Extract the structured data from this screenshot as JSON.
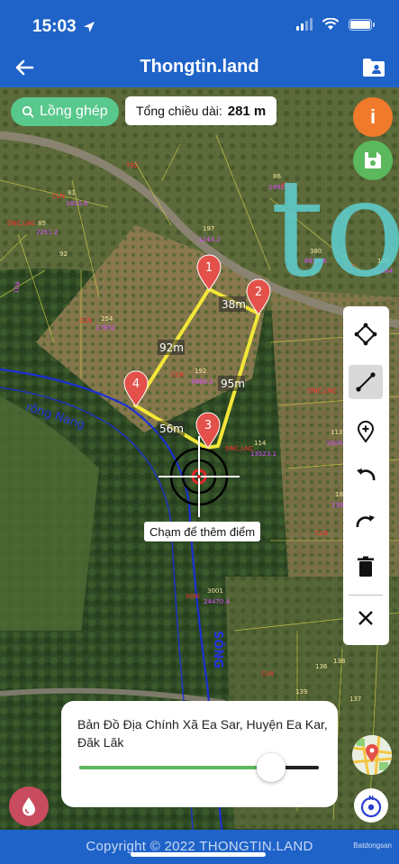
{
  "status": {
    "time": "15:03"
  },
  "header": {
    "title": "Thongtin.land"
  },
  "toolbar": {
    "merge_label": "Lồng ghép",
    "length_label": "Tổng chiều dài:",
    "length_value": "281 m"
  },
  "map": {
    "segments": [
      "38m",
      "95m",
      "56m",
      "92m"
    ],
    "markers": [
      "1",
      "2",
      "3",
      "4"
    ],
    "river_label": "rông Nang",
    "river_label2": "SÔNG",
    "overlay_text": "to",
    "hint": "Chạm để thêm điểm",
    "parcel_labels": [
      "197",
      "192",
      "254",
      "114",
      "113",
      "181",
      "3001",
      "139",
      "137",
      "100",
      "81",
      "85",
      "92",
      "104",
      "86",
      "380",
      "136",
      "138"
    ]
  },
  "tools": [
    "crop",
    "line",
    "add-point",
    "undo",
    "redo",
    "delete",
    "close"
  ],
  "layer": {
    "title": "Bản Đồ Địa Chính Xã Ea Sar, Huyện Ea Kar, Đăk Lăk",
    "opacity": 0.8
  },
  "footer": {
    "copyright": "Copyright © 2022 THONGTIN.LAND",
    "watermark": "Batdongsan"
  },
  "colors": {
    "brand": "#1f63c9",
    "accent_green": "#5cb85c",
    "polygon": "#f2e638",
    "marker": "#e3514a"
  }
}
